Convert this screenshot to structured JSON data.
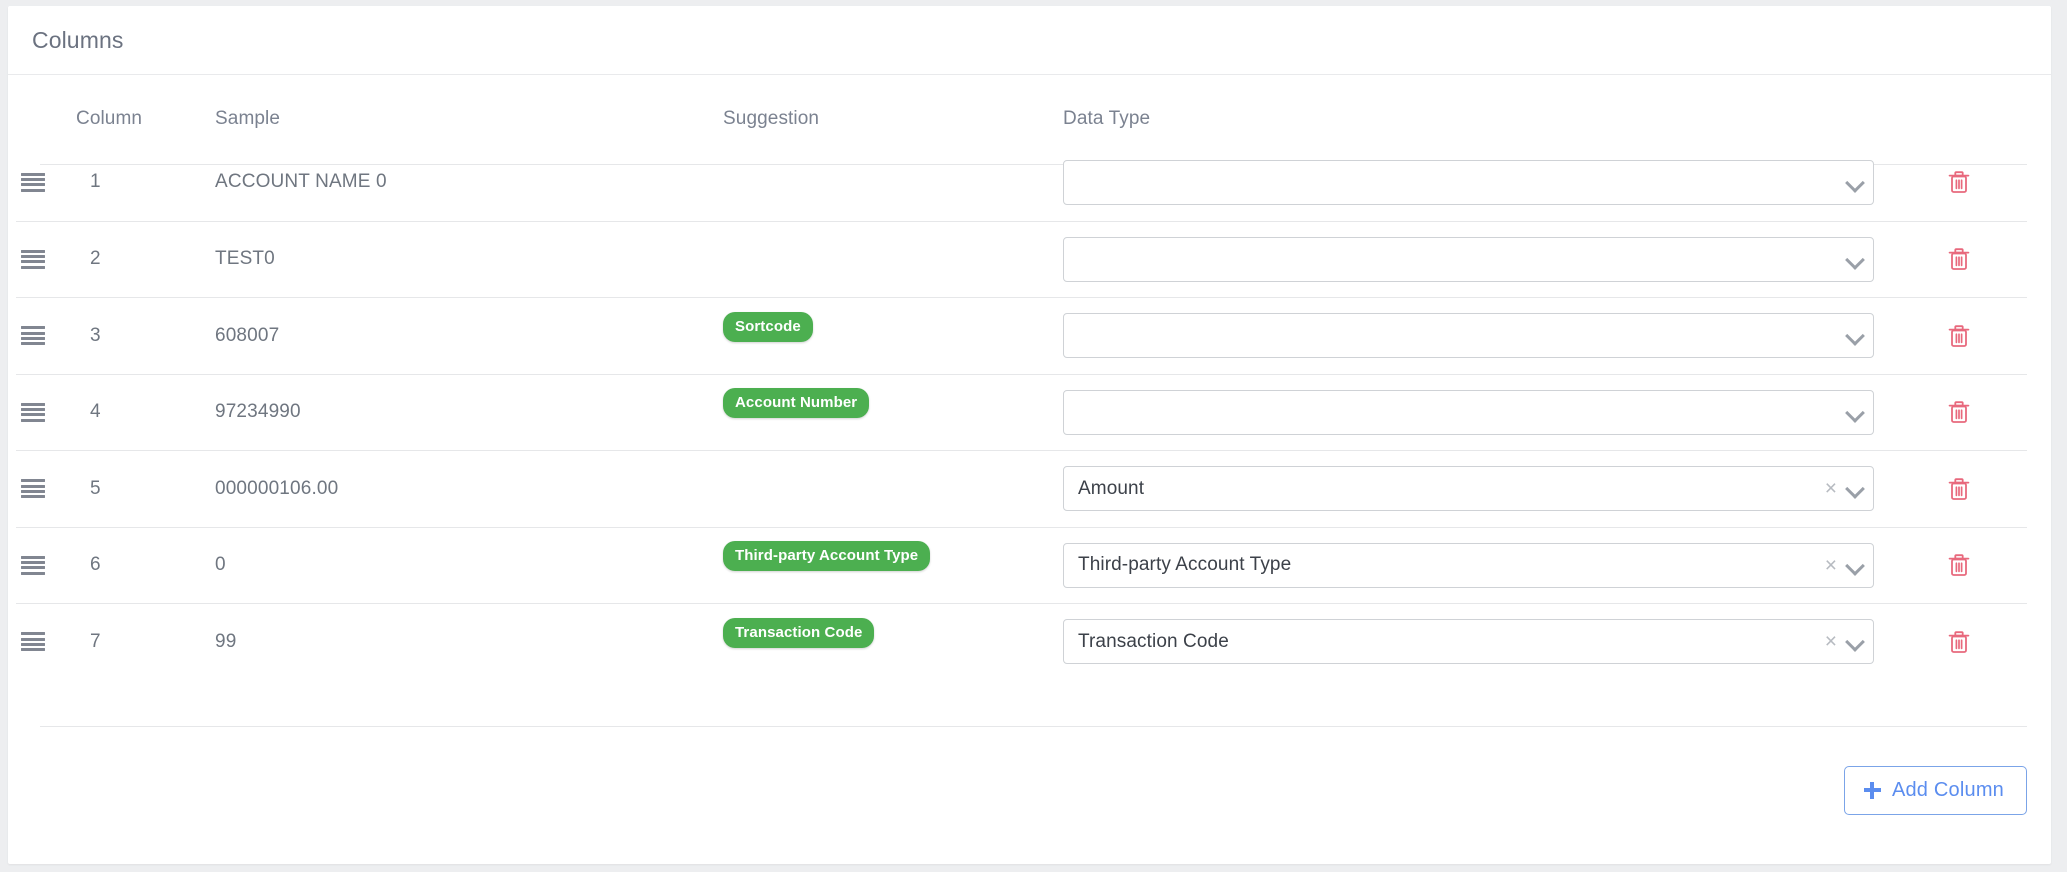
{
  "card": {
    "title": "Columns"
  },
  "table": {
    "headers": {
      "column": "Column",
      "sample": "Sample",
      "suggestion": "Suggestion",
      "data_type": "Data Type"
    },
    "rows": [
      {
        "index": "1",
        "sample": "ACCOUNT NAME 0",
        "suggestion": "",
        "data_type": "",
        "has_value": false,
        "drag_handle_icon": "drag-handle-icon",
        "delete_icon": "trash-icon"
      },
      {
        "index": "2",
        "sample": "TEST0",
        "suggestion": "",
        "data_type": "",
        "has_value": false,
        "drag_handle_icon": "drag-handle-icon",
        "delete_icon": "trash-icon"
      },
      {
        "index": "3",
        "sample": "608007",
        "suggestion": "Sortcode",
        "data_type": "",
        "has_value": false,
        "drag_handle_icon": "drag-handle-icon",
        "delete_icon": "trash-icon"
      },
      {
        "index": "4",
        "sample": "97234990",
        "suggestion": "Account Number",
        "data_type": "",
        "has_value": false,
        "drag_handle_icon": "drag-handle-icon",
        "delete_icon": "trash-icon"
      },
      {
        "index": "5",
        "sample": "000000106.00",
        "suggestion": "",
        "data_type": "Amount",
        "has_value": true,
        "drag_handle_icon": "drag-handle-icon",
        "delete_icon": "trash-icon"
      },
      {
        "index": "6",
        "sample": "0",
        "suggestion": "Third-party Account Type",
        "data_type": "Third-party Account Type",
        "has_value": true,
        "drag_handle_icon": "drag-handle-icon",
        "delete_icon": "trash-icon"
      },
      {
        "index": "7",
        "sample": "99",
        "suggestion": "Transaction Code",
        "data_type": "Transaction Code",
        "has_value": true,
        "drag_handle_icon": "drag-handle-icon",
        "delete_icon": "trash-icon"
      }
    ]
  },
  "footer": {
    "add_column_label": "Add Column",
    "add_column_icon": "plus-icon"
  },
  "select_control": {
    "clear_icon": "close-x-icon",
    "chevron_icon": "chevron-down-icon",
    "clear_glyph": "×"
  },
  "colors": {
    "page_background": "#edeef0",
    "card_background": "#ffffff",
    "badge_green": "#4caf50",
    "accent_blue": "#5b8def",
    "delete_red": "#e8697d",
    "text_gray": "#6f7680",
    "border_gray": "#e6e7e9"
  }
}
